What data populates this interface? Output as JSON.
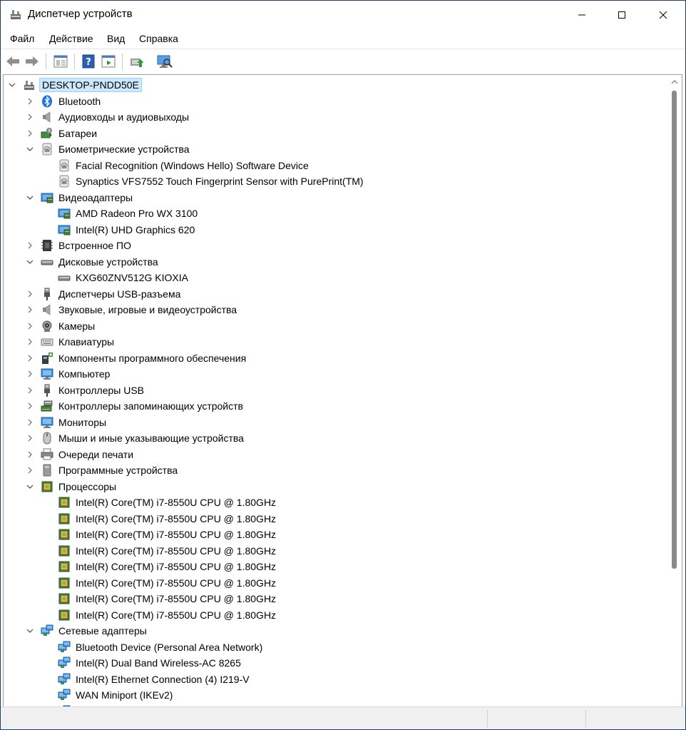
{
  "window": {
    "title": "Диспетчер устройств",
    "accent": "#1c3f6e"
  },
  "menu": {
    "items": [
      "Файл",
      "Действие",
      "Вид",
      "Справка"
    ]
  },
  "tree": {
    "root": "DESKTOP-PNDD50E",
    "categories": [
      {
        "label": "Bluetooth",
        "icon": "bluetooth-icon",
        "expanded": false,
        "children": []
      },
      {
        "label": "Аудиовходы и аудиовыходы",
        "icon": "speaker-icon",
        "expanded": false,
        "children": []
      },
      {
        "label": "Батареи",
        "icon": "battery-icon",
        "expanded": false,
        "children": []
      },
      {
        "label": "Биометрические устройства",
        "icon": "fingerprint-icon",
        "expanded": true,
        "children": [
          {
            "label": "Facial Recognition (Windows Hello) Software Device",
            "icon": "fingerprint-icon"
          },
          {
            "label": "Synaptics VFS7552 Touch Fingerprint Sensor with PurePrint(TM)",
            "icon": "fingerprint-icon"
          }
        ]
      },
      {
        "label": "Видеоадаптеры",
        "icon": "display-adapter-icon",
        "expanded": true,
        "children": [
          {
            "label": "AMD Radeon Pro WX 3100",
            "icon": "display-adapter-icon"
          },
          {
            "label": "Intel(R) UHD Graphics 620",
            "icon": "display-adapter-icon"
          }
        ]
      },
      {
        "label": "Встроенное ПО",
        "icon": "firmware-icon",
        "expanded": false,
        "children": []
      },
      {
        "label": "Дисковые устройства",
        "icon": "disk-drive-icon",
        "expanded": true,
        "children": [
          {
            "label": "KXG60ZNV512G KIOXIA",
            "icon": "disk-drive-icon"
          }
        ]
      },
      {
        "label": "Диспетчеры USB-разъема",
        "icon": "usb-icon",
        "expanded": false,
        "children": []
      },
      {
        "label": "Звуковые, игровые и видеоустройства",
        "icon": "speaker-icon",
        "expanded": false,
        "children": []
      },
      {
        "label": "Камеры",
        "icon": "camera-icon",
        "expanded": false,
        "children": []
      },
      {
        "label": "Клавиатуры",
        "icon": "keyboard-icon",
        "expanded": false,
        "children": []
      },
      {
        "label": "Компоненты программного обеспечения",
        "icon": "software-component-icon",
        "expanded": false,
        "children": []
      },
      {
        "label": "Компьютер",
        "icon": "computer-icon",
        "expanded": false,
        "children": []
      },
      {
        "label": "Контроллеры USB",
        "icon": "usb-icon",
        "expanded": false,
        "children": []
      },
      {
        "label": "Контроллеры запоминающих устройств",
        "icon": "storage-controller-icon",
        "expanded": false,
        "children": []
      },
      {
        "label": "Мониторы",
        "icon": "monitor-icon",
        "expanded": false,
        "children": []
      },
      {
        "label": "Мыши и иные указывающие устройства",
        "icon": "mouse-icon",
        "expanded": false,
        "children": []
      },
      {
        "label": "Очереди печати",
        "icon": "printer-icon",
        "expanded": false,
        "children": []
      },
      {
        "label": "Программные устройства",
        "icon": "software-device-icon",
        "expanded": false,
        "children": []
      },
      {
        "label": "Процессоры",
        "icon": "processor-icon",
        "expanded": true,
        "children": [
          {
            "label": "Intel(R) Core(TM) i7-8550U CPU @ 1.80GHz",
            "icon": "processor-icon"
          },
          {
            "label": "Intel(R) Core(TM) i7-8550U CPU @ 1.80GHz",
            "icon": "processor-icon"
          },
          {
            "label": "Intel(R) Core(TM) i7-8550U CPU @ 1.80GHz",
            "icon": "processor-icon"
          },
          {
            "label": "Intel(R) Core(TM) i7-8550U CPU @ 1.80GHz",
            "icon": "processor-icon"
          },
          {
            "label": "Intel(R) Core(TM) i7-8550U CPU @ 1.80GHz",
            "icon": "processor-icon"
          },
          {
            "label": "Intel(R) Core(TM) i7-8550U CPU @ 1.80GHz",
            "icon": "processor-icon"
          },
          {
            "label": "Intel(R) Core(TM) i7-8550U CPU @ 1.80GHz",
            "icon": "processor-icon"
          },
          {
            "label": "Intel(R) Core(TM) i7-8550U CPU @ 1.80GHz",
            "icon": "processor-icon"
          }
        ]
      },
      {
        "label": "Сетевые адаптеры",
        "icon": "network-adapter-icon",
        "expanded": true,
        "children": [
          {
            "label": "Bluetooth Device (Personal Area Network)",
            "icon": "network-adapter-icon"
          },
          {
            "label": "Intel(R) Dual Band Wireless-AC 8265",
            "icon": "network-adapter-icon"
          },
          {
            "label": "Intel(R) Ethernet Connection (4) I219-V",
            "icon": "network-adapter-icon"
          },
          {
            "label": "WAN Miniport (IKEv2)",
            "icon": "network-adapter-icon"
          },
          {
            "label": "",
            "icon": "network-adapter-icon"
          }
        ]
      }
    ]
  }
}
